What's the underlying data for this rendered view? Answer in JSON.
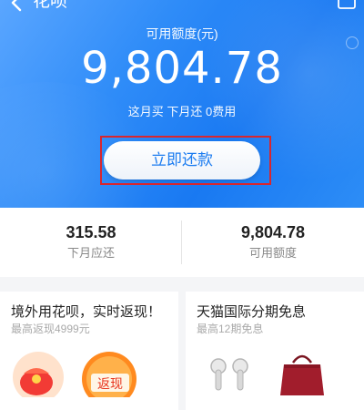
{
  "nav": {
    "title": "花呗",
    "back_icon": "back-arrow-icon",
    "more_icon": "message-icon"
  },
  "header": {
    "available_label": "可用额度(元)",
    "available_amount": "9,804.78",
    "note": "这月买 下月还 0费用",
    "repay_button": "立即还款"
  },
  "stats": [
    {
      "value": "315.58",
      "label": "下月应还"
    },
    {
      "value": "9,804.78",
      "label": "可用额度"
    }
  ],
  "promos": [
    {
      "title": "境外用花呗，实时返现！",
      "subtitle": "最高返现4999元",
      "badge": "返现",
      "art": "red-envelope-coin-icon"
    },
    {
      "title": "天猫国际分期免息",
      "subtitle": "最高12期免息",
      "art": "earphones-handbag-icon"
    }
  ],
  "colors": {
    "brand_blue": "#1c7cf0",
    "highlight_red": "#d8262e",
    "badge_orange": "#ff7a1a"
  }
}
